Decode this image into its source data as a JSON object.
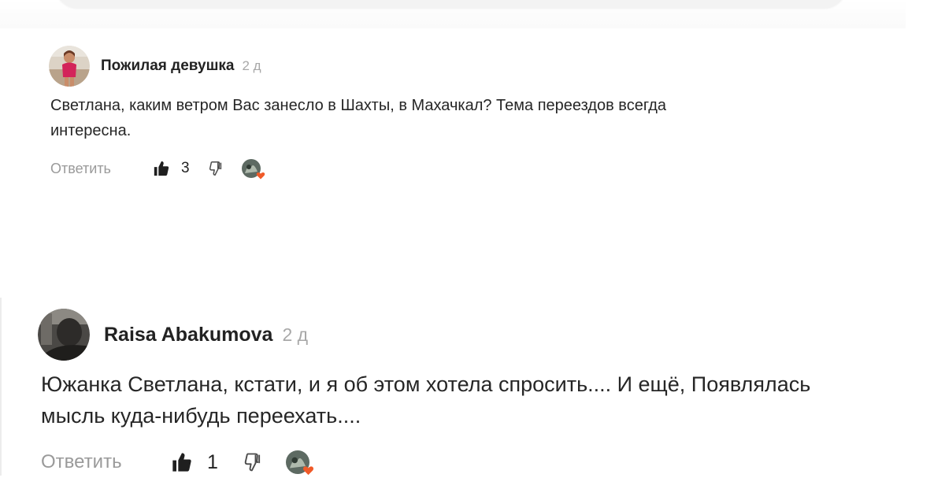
{
  "comments": [
    {
      "author": "Пожилая девушка",
      "time": "2 д",
      "text": "Светлана, каким ветром Вас занесло в Шахты, в Махачкал? Тема переездов всегда\nинтересна.",
      "reply_label": "Ответить",
      "likes": "3",
      "avatar_icon": "woman-photo-avatar",
      "reaction_icon": "reactor-avatar-with-heart"
    },
    {
      "author": "Raisa Abakumova",
      "time": "2 д",
      "text_line1": "Южанка Светлана, кстати, и я об этом хотела спросить.... И ещё, Появлялась",
      "text_line2": "мысль куда-нибудь переехать....",
      "reply_label": "Ответить",
      "likes": "1",
      "avatar_icon": "man-photo-avatar",
      "reaction_icon": "reactor-avatar-with-heart"
    }
  ],
  "colors": {
    "heart": "#f05a28",
    "muted": "#9a9a9a",
    "text": "#262626"
  }
}
